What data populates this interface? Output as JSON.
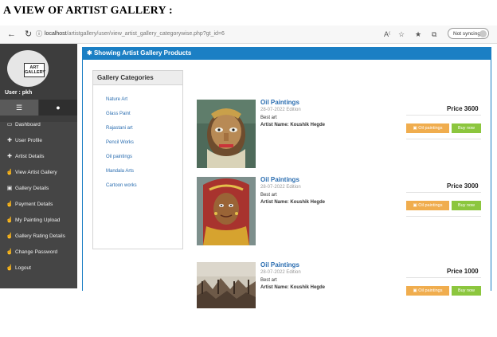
{
  "document": {
    "heading": "A VIEW OF ARTIST GALLERY :"
  },
  "browser": {
    "url_host": "localhost",
    "url_path": "/artistgallery/user/view_artist_gallery_categorywise.php?gt_id=6",
    "sync_label": "Not syncing",
    "icons": [
      "back-icon",
      "refresh-icon",
      "info-icon",
      "read-aloud-icon",
      "favorite-icon",
      "favorites-list-icon",
      "collections-icon"
    ]
  },
  "sidebar": {
    "logo_text_line1": "ART",
    "logo_text_line2": "GALLERY",
    "user_label": "User : pkh",
    "tab_icons": [
      "list-icon",
      "user-icon"
    ],
    "items": [
      {
        "label": "Dashboard",
        "icon": "monitor-icon"
      },
      {
        "label": "User Profile",
        "icon": "pencil-icon"
      },
      {
        "label": "Artist Details",
        "icon": "pencil-icon"
      },
      {
        "label": "View Artist Gallery",
        "icon": "hand-icon"
      },
      {
        "label": "Gallery Details",
        "icon": "gallery-icon"
      },
      {
        "label": "Payment Details",
        "icon": "hand-icon"
      },
      {
        "label": "My Painting Upload",
        "icon": "hand-icon"
      },
      {
        "label": "Gallery Rating Details",
        "icon": "hand-icon"
      },
      {
        "label": "Change Password",
        "icon": "hand-icon"
      },
      {
        "label": "Logout",
        "icon": "hand-icon"
      }
    ]
  },
  "panel": {
    "title": "Showing Artist Gallery Products",
    "accent": "#1b7fc4"
  },
  "categories": {
    "title": "Gallery Categories",
    "items": [
      "Nature Art",
      "Glass Paint",
      "Rajastani art",
      "Pencil Works",
      "Oil paintings",
      "Mandala Arts",
      "Cartoon works"
    ]
  },
  "products": [
    {
      "title": "Oil Paintings",
      "edition": "28-07-2022 Edition",
      "category": "Best art",
      "artist": "Artist Name: Koushik Hegde",
      "price": "Price 3600",
      "cat_button": "Oil paintings",
      "buy_button": "Buy now"
    },
    {
      "title": "Oil Paintings",
      "edition": "28-07-2022 Edition",
      "category": "Best art",
      "artist": "Artist Name: Koushik Hegde",
      "price": "Price 3000",
      "cat_button": "Oil paintings",
      "buy_button": "Buy now"
    },
    {
      "title": "Oil Paintings",
      "edition": "28-07-2022 Edition",
      "category": "Best art",
      "artist": "Artist Name: Koushik Hegde",
      "price": "Price 1000",
      "cat_button": "Oil paintings",
      "buy_button": "Buy now"
    }
  ],
  "colors": {
    "warning": "#f0ad4e",
    "success": "#8cc63e",
    "link": "#2a6db0",
    "sidebar": "#454545"
  }
}
